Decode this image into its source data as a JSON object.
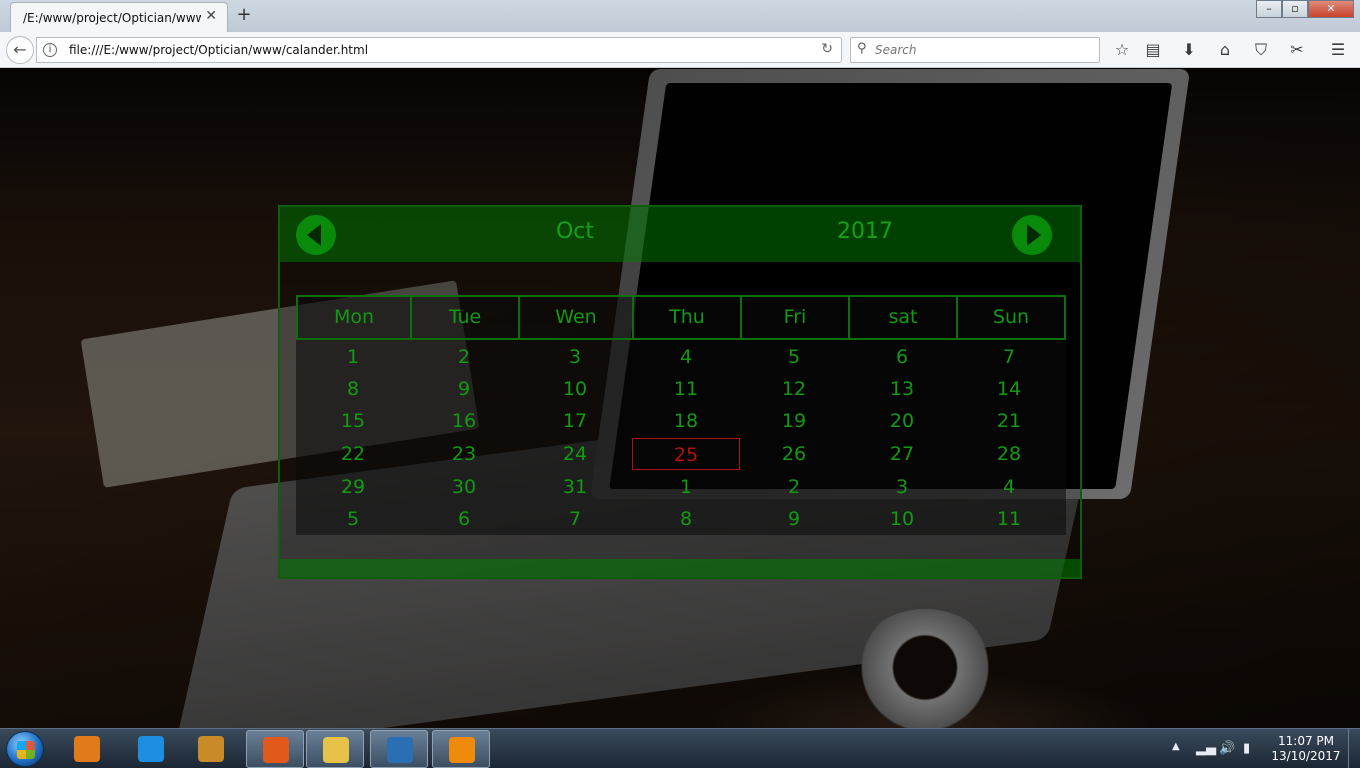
{
  "browser": {
    "tab_title": "/E:/www/project/Optician/www/",
    "tab_close": "✕",
    "new_tab": "+",
    "url": "file:///E:/www/project/Optician/www/calander.html",
    "search_placeholder": "Search",
    "window_controls": {
      "minimize": "–",
      "maximize": "▫",
      "close": "✕"
    }
  },
  "calendar": {
    "month": "Oct",
    "year": "2017",
    "weekdays": [
      "Mon",
      "Tue",
      "Wen",
      "Thu",
      "Fri",
      "sat",
      "Sun"
    ],
    "weeks": [
      [
        "1",
        "2",
        "3",
        "4",
        "5",
        "6",
        "7"
      ],
      [
        "8",
        "9",
        "10",
        "11",
        "12",
        "13",
        "14"
      ],
      [
        "15",
        "16",
        "17",
        "18",
        "19",
        "20",
        "21"
      ],
      [
        "22",
        "23",
        "24",
        "25",
        "26",
        "27",
        "28"
      ],
      [
        "29",
        "30",
        "31",
        "1",
        "2",
        "3",
        "4"
      ],
      [
        "5",
        "6",
        "7",
        "8",
        "9",
        "10",
        "11"
      ]
    ],
    "highlighted_day": "25",
    "colors": {
      "text": "#129a12",
      "highlight": "#b30f0f",
      "header": "#008000"
    }
  },
  "taskbar": {
    "apps": [
      {
        "name": "windows-media-player",
        "color": "#e07a1a"
      },
      {
        "name": "internet-explorer",
        "color": "#1e8fe0"
      },
      {
        "name": "word",
        "color": "#c98a2a"
      },
      {
        "name": "firefox",
        "color": "#e2591d"
      },
      {
        "name": "file-explorer",
        "color": "#e6c24a"
      },
      {
        "name": "brackets",
        "color": "#2a6fb3"
      },
      {
        "name": "vlc",
        "color": "#f08a0a"
      }
    ],
    "time": "11:07 PM",
    "date": "13/10/2017"
  }
}
